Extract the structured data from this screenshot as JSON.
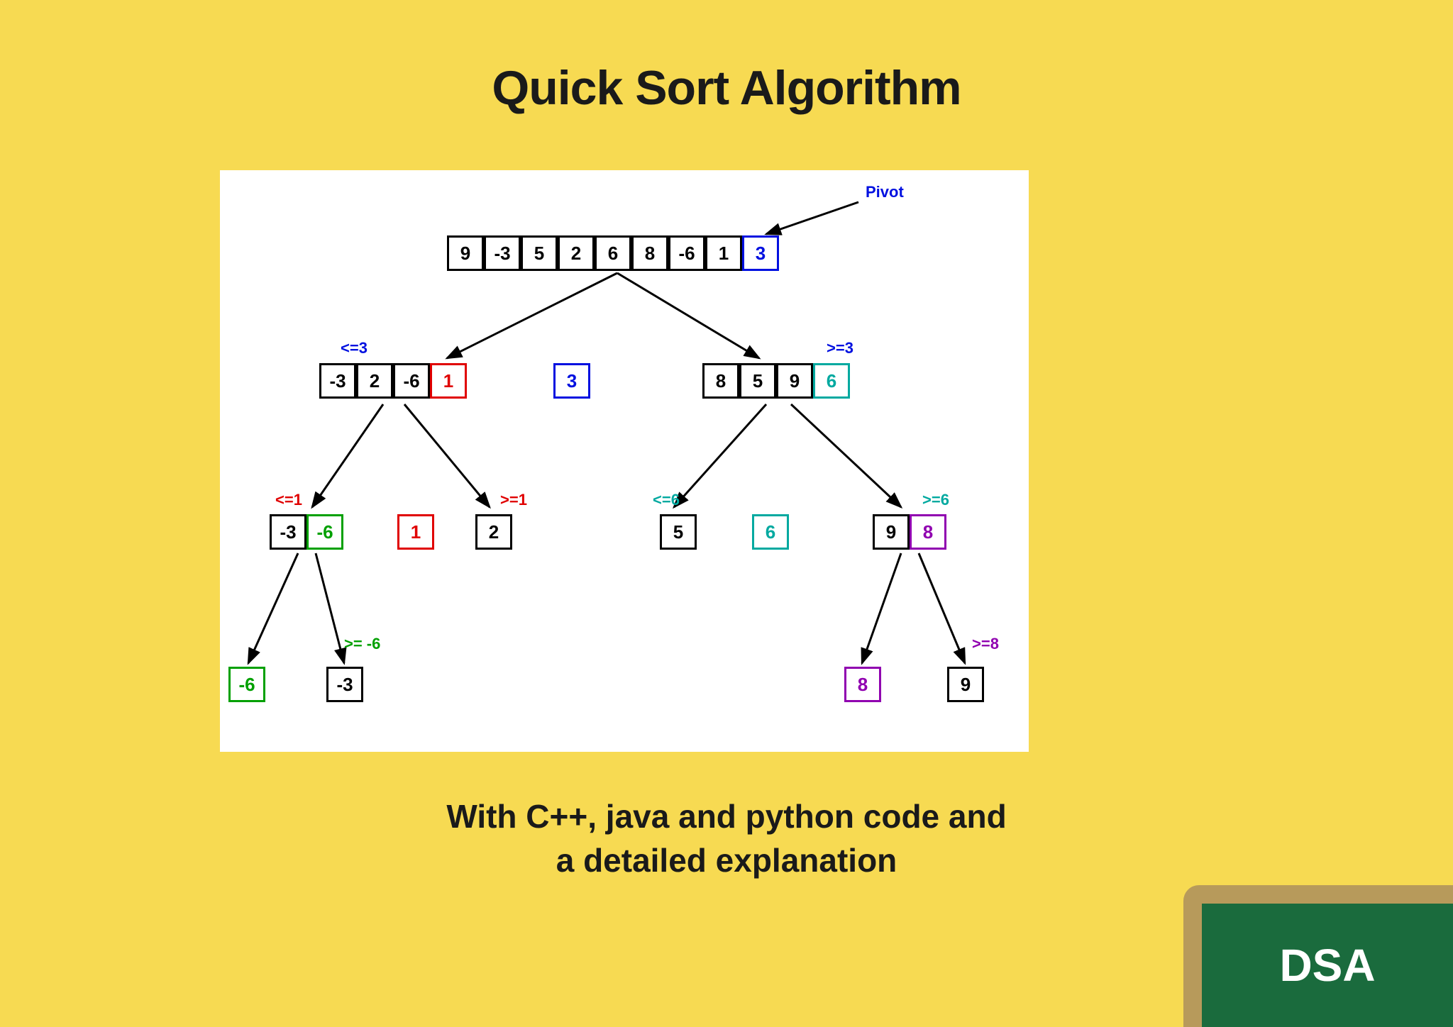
{
  "title": "Quick Sort Algorithm",
  "subtitle": "With C++, java and python code and a detailed explanation",
  "badge": "DSA",
  "pivot_label": "Pivot",
  "level0": {
    "cells": [
      {
        "v": "9",
        "c": ""
      },
      {
        "v": "-3",
        "c": ""
      },
      {
        "v": "5",
        "c": ""
      },
      {
        "v": "2",
        "c": ""
      },
      {
        "v": "6",
        "c": ""
      },
      {
        "v": "8",
        "c": ""
      },
      {
        "v": "-6",
        "c": ""
      },
      {
        "v": "1",
        "c": ""
      },
      {
        "v": "3",
        "c": "blue"
      }
    ]
  },
  "level1": {
    "left_label": "<=3",
    "right_label": ">=3",
    "left": [
      {
        "v": "-3",
        "c": ""
      },
      {
        "v": "2",
        "c": ""
      },
      {
        "v": "-6",
        "c": ""
      },
      {
        "v": "1",
        "c": "red"
      }
    ],
    "mid": [
      {
        "v": "3",
        "c": "blue"
      }
    ],
    "right": [
      {
        "v": "8",
        "c": ""
      },
      {
        "v": "5",
        "c": ""
      },
      {
        "v": "9",
        "c": ""
      },
      {
        "v": "6",
        "c": "teal"
      }
    ]
  },
  "level2": {
    "l_left_label": "<=1",
    "l_right_label": ">=1",
    "r_left_label": "<=6",
    "r_right_label": ">=6",
    "ll": [
      {
        "v": "-3",
        "c": ""
      },
      {
        "v": "-6",
        "c": "green"
      }
    ],
    "lm": [
      {
        "v": "1",
        "c": "red"
      }
    ],
    "lr": [
      {
        "v": "2",
        "c": ""
      }
    ],
    "rl": [
      {
        "v": "5",
        "c": ""
      }
    ],
    "rm": [
      {
        "v": "6",
        "c": "teal"
      }
    ],
    "rr": [
      {
        "v": "9",
        "c": ""
      },
      {
        "v": "8",
        "c": "purple"
      }
    ]
  },
  "level3": {
    "ll_right_label": ">= -6",
    "rr_right_label": ">=8",
    "lll": [
      {
        "v": "-6",
        "c": "green"
      }
    ],
    "llr": [
      {
        "v": "-3",
        "c": ""
      }
    ],
    "rrl": [
      {
        "v": "8",
        "c": "purple"
      }
    ],
    "rrr": [
      {
        "v": "9",
        "c": ""
      }
    ]
  }
}
